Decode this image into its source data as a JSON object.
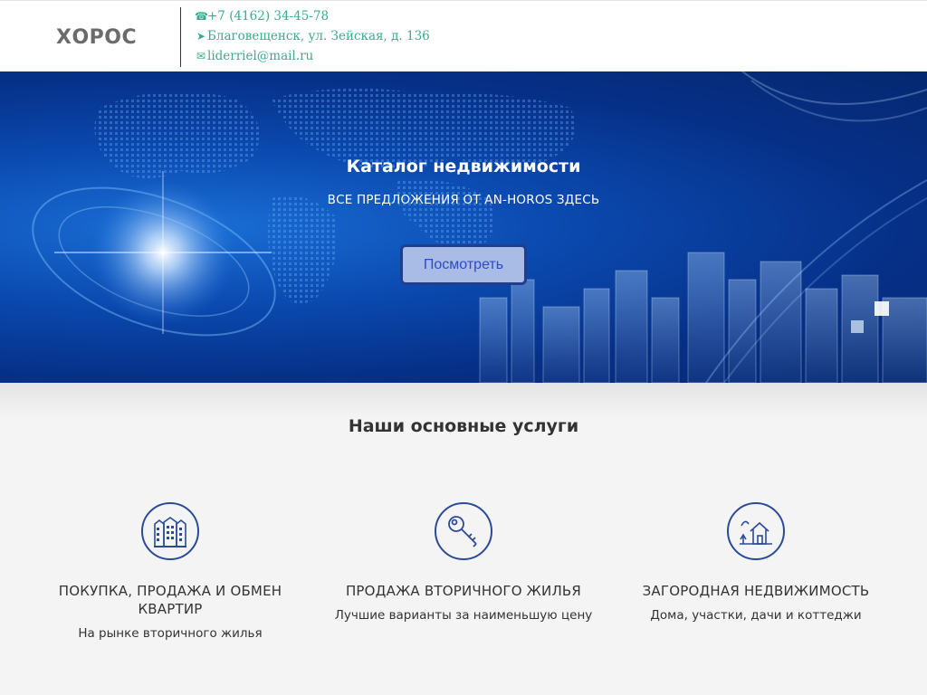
{
  "header": {
    "logo": "ХОРОС",
    "phone": "+7 (4162) 34-45-78",
    "address": "Благовещенск, ул. Зейская, д. 136",
    "email": "liderriel@mail.ru",
    "phone_icon": "phone-icon",
    "address_icon": "arrow-icon",
    "email_icon": "envelope-icon",
    "accent_color": "#3aaa8e"
  },
  "hero": {
    "title": "Каталог недвижимости",
    "subtitle": "ВСЕ ПРЕДЛОЖЕНИЯ ОТ AN-HOROS ЗДЕСЬ",
    "button_label": "Посмотреть"
  },
  "services": {
    "title": "Наши основные услуги",
    "items": [
      {
        "name": "ПОКУПКА, ПРОДАЖА И ОБМЕН КВАРТИР",
        "desc": "На рынке вторичного жилья",
        "icon": "building-icon"
      },
      {
        "name": "ПРОДАЖА ВТОРИЧНОГО ЖИЛЬЯ",
        "desc": "Лучшие варианты за наименьшую цену",
        "icon": "key-icon"
      },
      {
        "name": "ЗАГОРОДНАЯ НЕДВИЖИМОСТЬ",
        "desc": "Дома, участки, дачи и коттеджи",
        "icon": "country-house-icon"
      }
    ]
  }
}
